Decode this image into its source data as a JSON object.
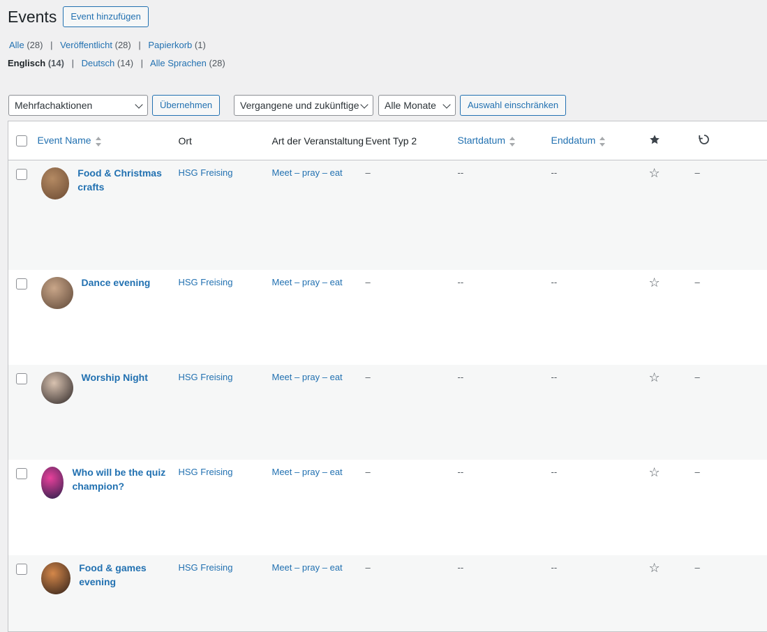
{
  "page": {
    "title": "Events",
    "add_button": "Event hinzufügen"
  },
  "status_filters": [
    {
      "label": "Alle",
      "count": "(28)"
    },
    {
      "label": "Veröffentlicht",
      "count": "(28)"
    },
    {
      "label": "Papierkorb",
      "count": "(1)"
    }
  ],
  "language_filters": [
    {
      "label": "Englisch",
      "count": "(14)",
      "current": true
    },
    {
      "label": "Deutsch",
      "count": "(14)"
    },
    {
      "label": "Alle Sprachen",
      "count": "(28)"
    }
  ],
  "toolbar": {
    "bulk_actions": "Mehrfachaktionen",
    "apply": "Übernehmen",
    "date_scope": "Vergangene und zukünftige",
    "months": "Alle Monate",
    "filter": "Auswahl einschränken"
  },
  "columns": {
    "event_name": "Event Name",
    "location": "Ort",
    "type": "Art der Veranstaltung",
    "type2": "Event Typ 2",
    "start": "Startdatum",
    "end": "Enddatum",
    "featured_icon": "star-filled",
    "recurring_icon": "undo"
  },
  "rows": [
    {
      "title": "Food & Christmas crafts",
      "location": "HSG Freising",
      "type": "Meet – pray – eat",
      "type2": "–",
      "start": "--",
      "end": "--",
      "recurring": "–",
      "thumb_colors": [
        "#b48a63",
        "#6b4a32"
      ]
    },
    {
      "title": "Dance evening",
      "location": "HSG Freising",
      "type": "Meet – pray – eat",
      "type2": "–",
      "start": "--",
      "end": "--",
      "recurring": "–",
      "thumb_colors": [
        "#c9a689",
        "#5d4636"
      ]
    },
    {
      "title": "Worship Night",
      "location": "HSG Freising",
      "type": "Meet – pray – eat",
      "type2": "–",
      "start": "--",
      "end": "--",
      "recurring": "–",
      "thumb_colors": [
        "#d8c2b0",
        "#2c2525"
      ]
    },
    {
      "title": "Who will be the quiz champion?",
      "location": "HSG Freising",
      "type": "Meet – pray – eat",
      "type2": "–",
      "start": "--",
      "end": "--",
      "recurring": "–",
      "thumb_colors": [
        "#e8419b",
        "#2a1e4a"
      ]
    },
    {
      "title": "Food & games evening",
      "location": "HSG Freising",
      "type": "Meet – pray – eat",
      "type2": "–",
      "start": "--",
      "end": "--",
      "recurring": "–",
      "thumb_colors": [
        "#d4874a",
        "#2d1f18"
      ]
    }
  ],
  "colors": {
    "link": "#2271b1",
    "background": "#f0f0f1"
  }
}
